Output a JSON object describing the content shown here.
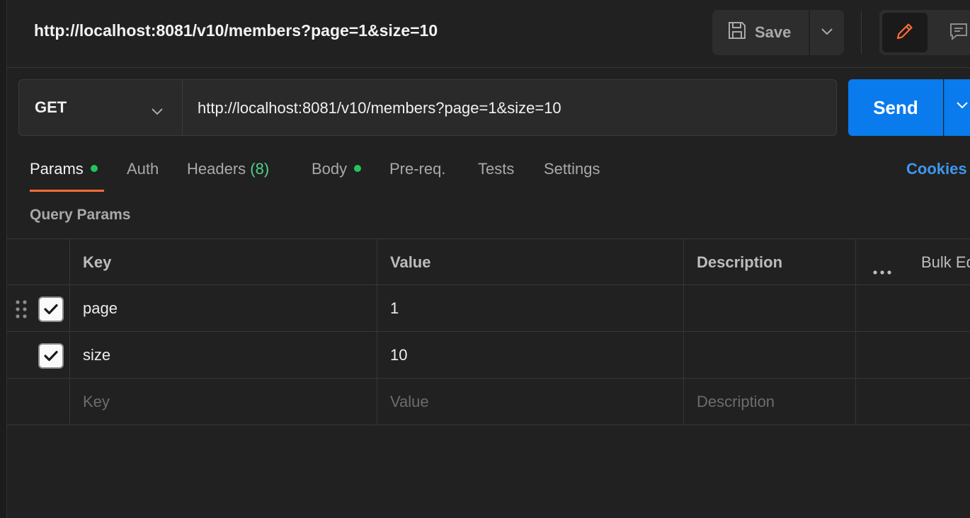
{
  "header": {
    "title": "http://localhost:8081/v10/members?page=1&size=10",
    "save_label": "Save"
  },
  "request": {
    "method": "GET",
    "url": "http://localhost:8081/v10/members?page=1&size=10",
    "send_label": "Send"
  },
  "tabs": [
    {
      "label": "Params",
      "dot": true,
      "active": true
    },
    {
      "label": "Auth"
    },
    {
      "label": "Headers",
      "count": "(8)"
    },
    {
      "label": "Body",
      "dot": true
    },
    {
      "label": "Pre-req."
    },
    {
      "label": "Tests"
    },
    {
      "label": "Settings"
    }
  ],
  "cookies_label": "Cookies",
  "query_params": {
    "title": "Query Params",
    "columns": {
      "key": "Key",
      "value": "Value",
      "description": "Description",
      "bulk_edit": "Bulk Edit"
    },
    "rows": [
      {
        "checked": true,
        "key": "page",
        "value": "1",
        "description": ""
      },
      {
        "checked": true,
        "key": "size",
        "value": "10",
        "description": ""
      }
    ],
    "placeholder": {
      "key": "Key",
      "value": "Value",
      "description": "Description"
    }
  },
  "colors": {
    "accent_orange": "#ff6c37",
    "send_blue": "#097bed",
    "dot_green": "#23c45e",
    "cookies_blue": "#3e97f0"
  },
  "icons": {
    "save": "floppy-disk-icon",
    "edit": "pencil-icon",
    "comment": "comment-icon",
    "drag": "drag-handle-icon",
    "more": "ellipsis-icon"
  }
}
